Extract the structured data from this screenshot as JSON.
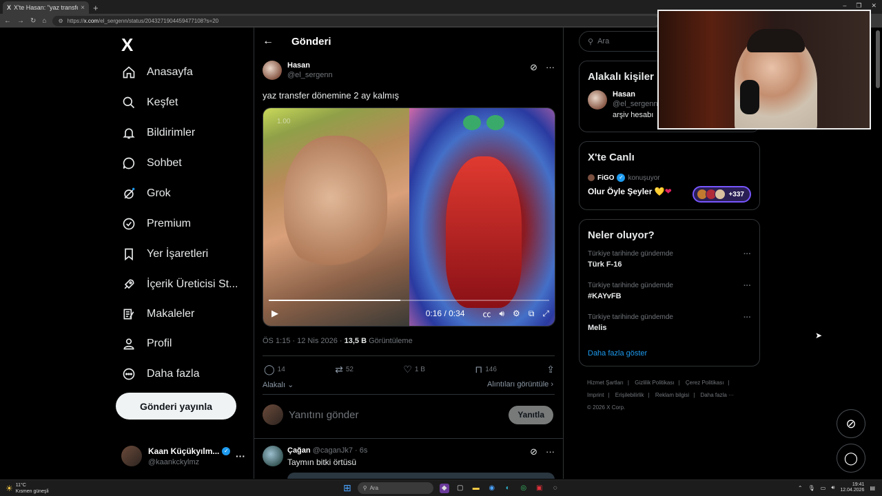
{
  "browser": {
    "tab_title": "X'te Hasan: \"yaz transfer dönemin...",
    "tab_close": "×",
    "new_tab": "+",
    "window_controls": [
      "–",
      "❐",
      "✕"
    ],
    "nav_buttons": [
      "←",
      "→",
      "↻",
      "⌂"
    ],
    "url_prefix": "https://",
    "url_domain": "x.com",
    "url_path": "/el_sergenn/status/2043271904459477108?s=20"
  },
  "sidebar": {
    "logo": "X",
    "items": [
      {
        "label": "Anasayfa",
        "icon": "home-icon"
      },
      {
        "label": "Keşfet",
        "icon": "search-icon"
      },
      {
        "label": "Bildirimler",
        "icon": "bell-icon"
      },
      {
        "label": "Sohbet",
        "icon": "chat-icon"
      },
      {
        "label": "Grok",
        "icon": "grok-icon"
      },
      {
        "label": "Premium",
        "icon": "premium-icon"
      },
      {
        "label": "Yer İşaretleri",
        "icon": "bookmark-icon"
      },
      {
        "label": "İçerik Üreticisi St...",
        "icon": "rocket-icon"
      },
      {
        "label": "Makaleler",
        "icon": "article-icon"
      },
      {
        "label": "Profil",
        "icon": "profile-icon"
      },
      {
        "label": "Daha fazla",
        "icon": "more-circle-icon"
      }
    ],
    "post_button": "Gönderi yayınla",
    "account": {
      "name": "Kaan Küçükyılm...",
      "handle": "@kaankckylmz",
      "more": "···"
    }
  },
  "post": {
    "header_title": "Gönderi",
    "author_name": "Hasan",
    "author_handle": "@el_sergenn",
    "text": "yaz transfer dönemine 2 ay kalmış",
    "video": {
      "speed_label": "1.00",
      "time": "0:16 / 0:34",
      "progress": 0.47
    },
    "meta_time": "ÖS 1:15 · 12 Nis 2026 · ",
    "meta_views": "13,5 B",
    "meta_views_label": " Görüntüleme",
    "stats": {
      "replies": "14",
      "reposts": "52",
      "likes": "1 B",
      "bookmarks": "146"
    },
    "related_label": "Alakalı",
    "quotes_label": "Alıntıları görüntüle",
    "reply_placeholder": "Yanıtını gönder",
    "reply_button": "Yanıtla"
  },
  "comment": {
    "name": "Çağan",
    "handle_time": "@caganJk7 · 6s",
    "text": "Taymın bitki örtüsü"
  },
  "right": {
    "search_placeholder": "Ara",
    "related_title": "Alakalı kişiler",
    "related_person": {
      "name": "Hasan",
      "handle": "@el_sergenn",
      "bio": "arşiv hesabı"
    },
    "live_title": "X'te Canlı",
    "live_host": "FiGO",
    "live_status": "konuşuyor",
    "live_stream_title": "Olur Öyle Şeyler",
    "live_hearts": [
      "💛",
      "❤"
    ],
    "live_count": "+337",
    "trends_title": "Neler oluyor?",
    "trends": [
      {
        "category": "Türkiye tarihinde gündemde",
        "name": "Türk F-16"
      },
      {
        "category": "Türkiye tarihinde gündemde",
        "name": "#KAYvFB"
      },
      {
        "category": "Türkiye tarihinde gündemde",
        "name": "Melis"
      }
    ],
    "show_more": "Daha fazla göster",
    "footer_links": [
      "Hizmet Şartları",
      "|",
      "Gizlilik Politikası",
      "|",
      "Çerez Politikası",
      "|",
      "Imprint",
      "|",
      "Erişilebilirlik",
      "|",
      "Reklam bilgisi",
      "|",
      "Daha fazla ···"
    ],
    "copyright": "© 2026 X Corp."
  },
  "taskbar": {
    "temperature": "11°C",
    "weather_desc": "Kısmen güneşli",
    "search_placeholder": "Ara",
    "time": "19:41",
    "date": "12.04.2026"
  }
}
